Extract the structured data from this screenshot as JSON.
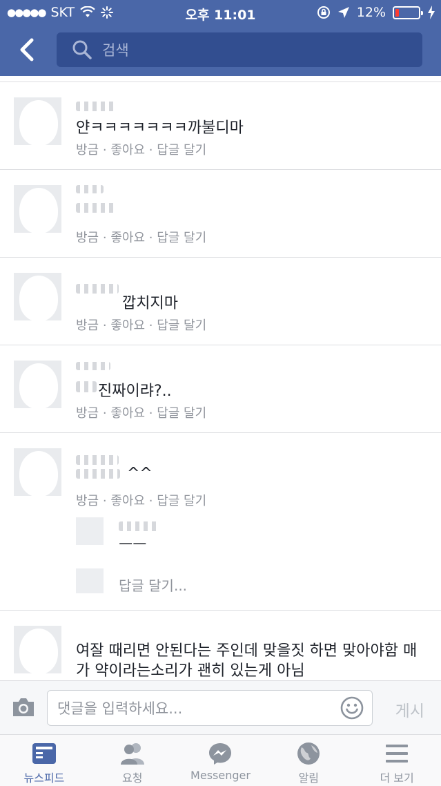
{
  "status_bar": {
    "carrier": "SKT",
    "time": "오후 11:01",
    "battery": "12%",
    "battery_level": 0.12
  },
  "header": {
    "search_placeholder": "검색",
    "back_icon": "chevron-left-icon",
    "search_icon": "search-icon"
  },
  "comment_meta": {
    "time": "방금",
    "like": "좋아요",
    "reply": "답글 달기",
    "separator": "·"
  },
  "comments": [
    {
      "text": "얀ㅋㅋㅋㅋㅋㅋㅋ까불디마"
    },
    {
      "text": ""
    },
    {
      "text": "깝치지마"
    },
    {
      "text": "진짜이랴?.."
    },
    {
      "text": "^^"
    }
  ],
  "nested_reply": {
    "text": "ㅡㅡ",
    "reply_link": "답글 달기..."
  },
  "last_comment": {
    "text": "여잘 때리면 안된다는 주인데 맞을짓 하면 맞아야함 매가 약이라는소리가 괜히 있는게 아님"
  },
  "composer": {
    "placeholder": "댓글을 입력하세요...",
    "post_label": "게시",
    "camera_icon": "camera-icon",
    "emoji_icon": "smiley-icon"
  },
  "tabbar": {
    "tabs": [
      {
        "label": "뉴스피드",
        "icon": "newsfeed-icon",
        "active": true
      },
      {
        "label": "요청",
        "icon": "friend-requests-icon",
        "active": false
      },
      {
        "label": "Messenger",
        "icon": "messenger-icon",
        "active": false
      },
      {
        "label": "알림",
        "icon": "globe-icon",
        "active": false
      },
      {
        "label": "더 보기",
        "icon": "menu-icon",
        "active": false
      }
    ]
  },
  "colors": {
    "brand": "#4a67a8",
    "meta_text": "#90949c",
    "battery_low": "#ff3b30"
  }
}
